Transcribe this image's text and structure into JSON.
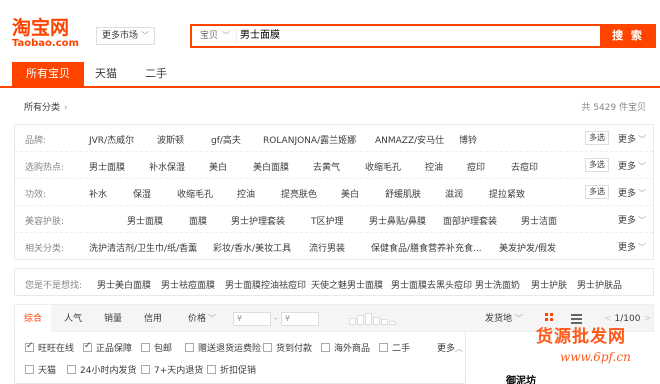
{
  "header": {
    "logo_cn": "淘宝网",
    "logo_en": "Taobao.com",
    "market_label": "更多市场",
    "search_type": "宝贝",
    "search_query": "男士面膜",
    "search_button": "搜 索"
  },
  "tabs": [
    {
      "label": "所有宝贝",
      "active": true
    },
    {
      "label": "天猫",
      "active": false
    },
    {
      "label": "二手",
      "active": false
    }
  ],
  "breadcrumb": {
    "label": "所有分类"
  },
  "result_count": "共 5429 件宝贝",
  "filters": [
    {
      "label": "品牌:",
      "values": [
        "JVR/杰威尔",
        "波斯顿",
        "gf/高夫",
        "ROLANJONA/露兰姬娜",
        "ANMAZZ/安马仕",
        "博铃"
      ],
      "multi": "多选",
      "more": "更多"
    },
    {
      "label": "选购热点:",
      "values": [
        "男士面膜",
        "补水保湿",
        "美白",
        "美白面膜",
        "去黄气",
        "收缩毛孔",
        "控油",
        "痘印",
        "去痘印"
      ],
      "multi": "多选",
      "more": "更多"
    },
    {
      "label": "功效:",
      "values": [
        "补水",
        "保湿",
        "收缩毛孔",
        "控油",
        "提亮肤色",
        "美白",
        "舒缓肌肤",
        "滋润",
        "提拉紧致"
      ],
      "multi": "多选",
      "more": "更多"
    },
    {
      "label": "美容护肤:",
      "values": [
        "男士面膜",
        "面膜",
        "男士护理套装",
        "T区护理",
        "男士鼻贴/鼻膜",
        "面部护理套装",
        "男士洁面"
      ],
      "multi": "",
      "more": "更多"
    },
    {
      "label": "相关分类:",
      "values": [
        "洗护清洁剂/卫生巾/纸/香薰",
        "彩妆/香水/美妆工具",
        "流行男装",
        "保健食品/膳食营养补充食...",
        "美发护发/假发"
      ],
      "multi": "",
      "more": "更多"
    }
  ],
  "suggest": {
    "label": "您是不是想找:",
    "values": [
      "男士美白面膜",
      "男士祛痘面膜",
      "男士面膜控油祛痘印",
      "天使之魅男士面膜",
      "男士面膜去黑头痘印",
      "男士洗面奶",
      "男士护肤",
      "男士护肤品"
    ]
  },
  "sortbar": {
    "items": [
      "综合",
      "人气",
      "销量",
      "信用",
      "价格"
    ],
    "price_from": "¥",
    "price_to": "¥",
    "dash": "-",
    "ship": "发货地",
    "pager": "1/100",
    "prev": "<",
    "next": ">"
  },
  "checks": [
    {
      "label": "旺旺在线",
      "on": true
    },
    {
      "label": "正品保障",
      "on": true
    },
    {
      "label": "包邮",
      "on": false
    },
    {
      "label": "赠送退货运费险",
      "on": false
    },
    {
      "label": "货到付款",
      "on": false
    },
    {
      "label": "海外商品",
      "on": false
    },
    {
      "label": "二手",
      "on": false
    },
    {
      "label": "天猫",
      "on": false
    },
    {
      "label": "24小时内发货",
      "on": false
    },
    {
      "label": "7+天内退货",
      "on": false
    },
    {
      "label": "折扣促销",
      "on": false
    }
  ],
  "checks_more": "更多",
  "partial_text": "御泥坊",
  "watermark": {
    "line1": "货源批发网",
    "line2": "www.6pf.cn"
  },
  "colors": {
    "accent": "#ff4400"
  }
}
